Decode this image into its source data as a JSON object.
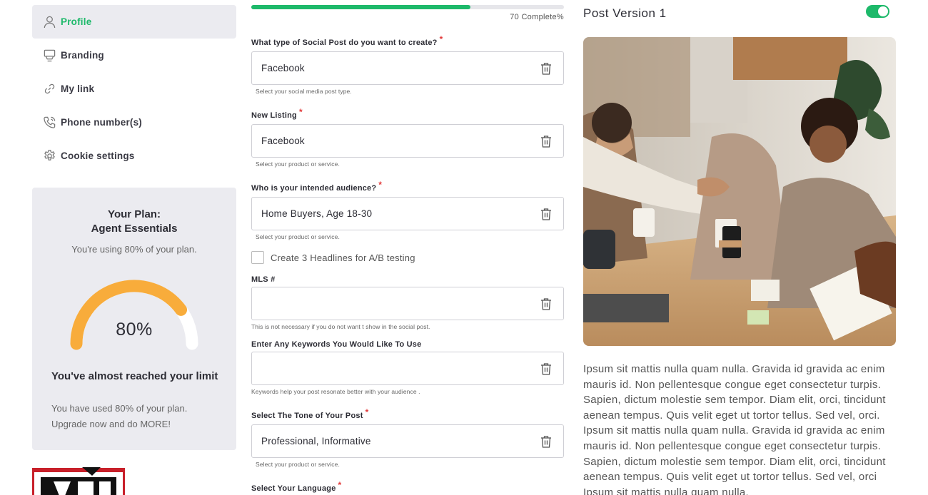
{
  "sidebar": {
    "items": [
      {
        "label": "Profile",
        "icon": "user-icon",
        "active": true
      },
      {
        "label": "Branding",
        "icon": "monitor-icon",
        "active": false
      },
      {
        "label": "My link",
        "icon": "link-icon",
        "active": false
      },
      {
        "label": "Phone number(s)",
        "icon": "phone-icon",
        "active": false
      },
      {
        "label": "Cookie settings",
        "icon": "gear-icon",
        "active": false
      }
    ]
  },
  "plan": {
    "title_line1": "Your Plan:",
    "title_line2": "Agent Essentials",
    "usage_text": "You're using 80% of your plan.",
    "gauge_percent": 80,
    "gauge_label": "80%",
    "limit_title": "You've almost reached your limit",
    "limit_line1": "You have used 80% of your plan.",
    "limit_line2": "Upgrade now and do MORE!"
  },
  "form": {
    "progress_percent": 70,
    "progress_label": "70 Complete%",
    "required_mark": "*",
    "fields": [
      {
        "label": "What type of Social Post do you want to create?",
        "required": true,
        "value": "Facebook",
        "help": "Select your social media post type."
      },
      {
        "label": "New Listing",
        "required": true,
        "value": "Facebook",
        "help": "Select your product or service."
      },
      {
        "label": "Who is your intended audience?",
        "required": true,
        "value": "Home Buyers, Age 18-30",
        "help": "Select your product or service."
      },
      {
        "label": "MLS #",
        "required": false,
        "value": "",
        "help": "This is not necessary if you do not want t show in the social post."
      },
      {
        "label": "Enter Any Keywords You Would Like To Use",
        "required": false,
        "value": "",
        "help": "Keywords help your post resonate better with your audience ."
      },
      {
        "label": "Select The Tone of Your Post",
        "required": true,
        "value": "Professional, Informative",
        "help": "Select your product or service."
      },
      {
        "label": "Select Your Language",
        "required": true
      }
    ],
    "checkbox_label": "Create 3 Headlines for A/B testing",
    "checkbox_checked": false
  },
  "preview": {
    "title": "Post Version 1",
    "toggle_on": true,
    "body": "Ipsum sit mattis nulla quam nulla. Gravida id gravida ac enim mauris id. Non pellentesque congue eget consectetur turpis. Sapien, dictum molestie sem tempor. Diam elit, orci, tincidunt aenean tempus. Quis velit eget ut tortor tellus. Sed vel, orci. Ipsum sit mattis nulla quam nulla. Gravida id gravida ac enim mauris id. Non pellentesque congue eget consectetur turpis. Sapien, dictum molestie sem tempor. Diam elit, orci, tincidunt aenean tempus. Quis velit eget ut tortor tellus. Sed vel, orci Ipsum sit mattis nulla quam nulla."
  },
  "colors": {
    "accent": "#1db96a",
    "gauge": "#f8ac3b",
    "required": "#e23b3b"
  }
}
